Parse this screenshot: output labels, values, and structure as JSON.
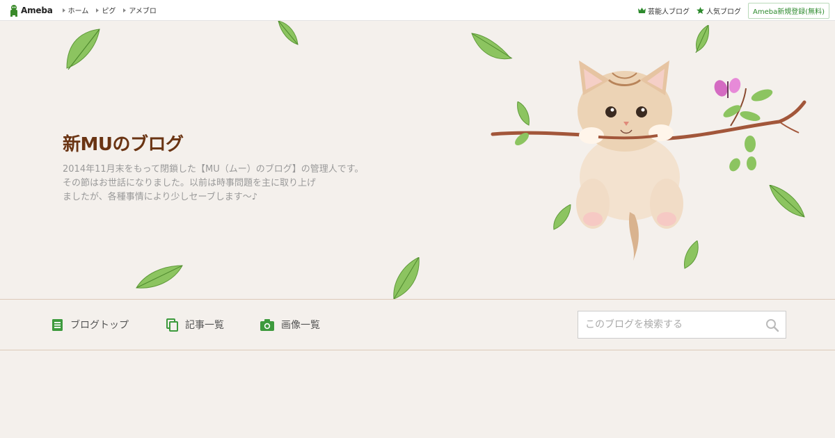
{
  "topbar": {
    "logo_text": "Ameba",
    "left_links": [
      "ホーム",
      "ピグ",
      "アメブロ"
    ],
    "right_links": [
      {
        "label": "芸能人ブログ",
        "icon": "crown-icon"
      },
      {
        "label": "人気ブログ",
        "icon": "star-icon"
      }
    ],
    "register_label": "Ameba新規登録(無料)"
  },
  "header": {
    "title": "新MUのブログ",
    "description_lines": [
      "2014年11月末をもって閉鎖した【MU（ムー）のブログ】の管理人です。",
      "その節はお世話になりました。以前は時事問題を主に取り上げ",
      "ましたが、各種事情により少しセーブします～♪"
    ]
  },
  "nav": {
    "items": [
      {
        "label": "ブログトップ",
        "icon": "document-icon"
      },
      {
        "label": "記事一覧",
        "icon": "copy-icon"
      },
      {
        "label": "画像一覧",
        "icon": "camera-icon"
      }
    ],
    "search_placeholder": "このブログを検索する"
  },
  "colors": {
    "accent_green": "#2d8a2d",
    "title_brown": "#6a3413",
    "background": "#f4f0ec"
  }
}
